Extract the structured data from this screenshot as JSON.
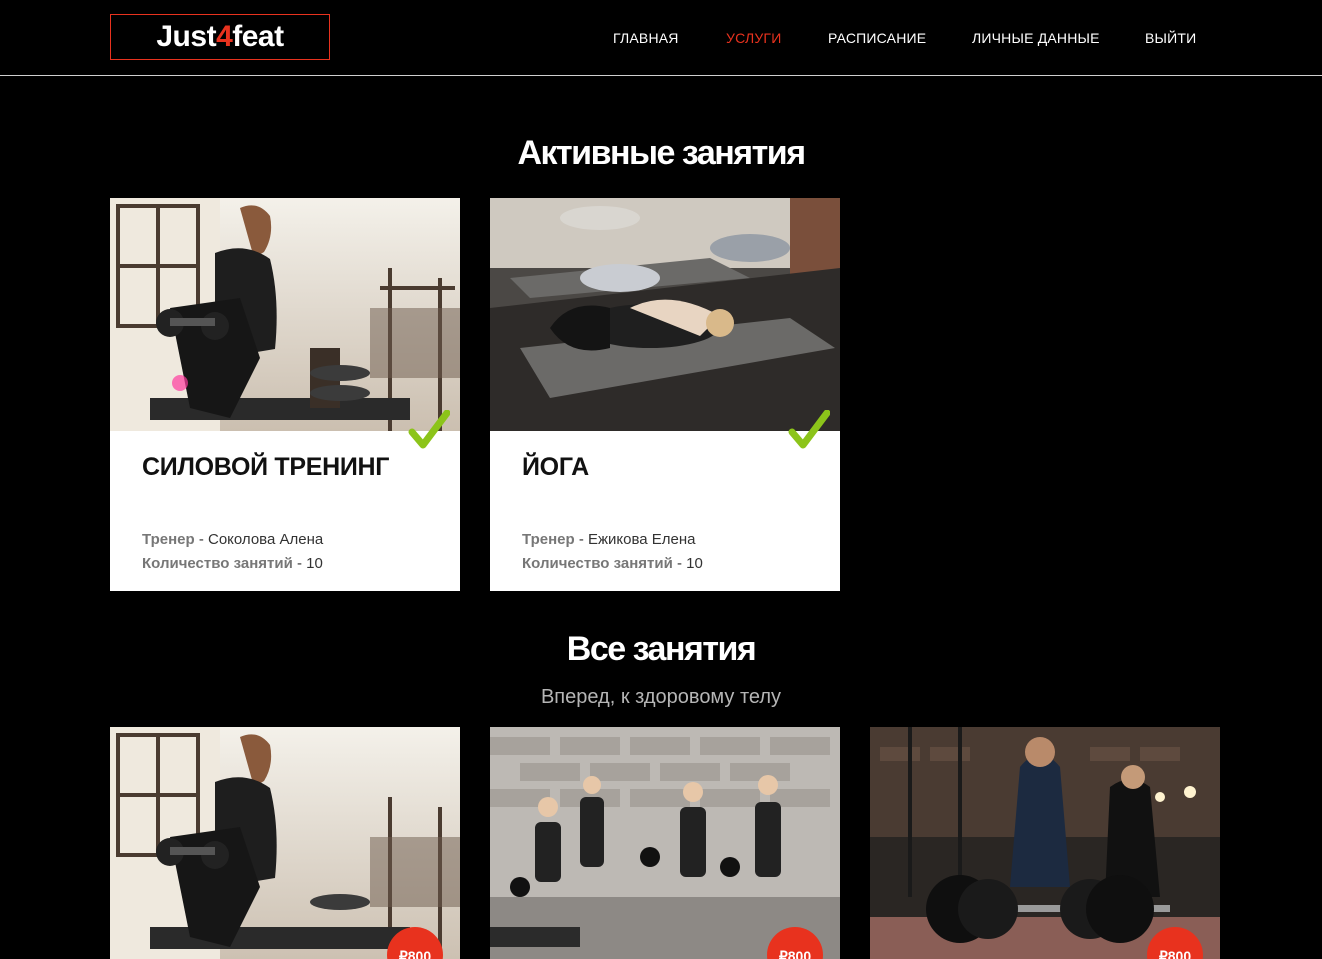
{
  "header": {
    "logo": {
      "part1": "Just",
      "part2": "4",
      "part3": "feat"
    },
    "nav": [
      {
        "label": "ГЛАВНАЯ",
        "active": false
      },
      {
        "label": "УСЛУГИ",
        "active": true
      },
      {
        "label": "РАСПИСАНИЕ",
        "active": false
      },
      {
        "label": "ЛИЧНЫЕ ДАННЫЕ",
        "active": false
      },
      {
        "label": "ВЫЙТИ",
        "active": false
      }
    ]
  },
  "active": {
    "title": "Активные занятия",
    "cards": [
      {
        "name": "СИЛОВОЙ ТРЕНИНГ",
        "trainer_label": "Тренер",
        "trainer": " - Соколова Алена",
        "count_label": "Количество занятий",
        "count": " - 10",
        "image": "strength-training-photo",
        "status_icon": "check-icon"
      },
      {
        "name": "ЙОГА",
        "trainer_label": "Тренер",
        "trainer": " - Ежикова Елена",
        "count_label": "Количество занятий",
        "count": " - 10",
        "image": "yoga-class-photo",
        "status_icon": "check-icon"
      }
    ]
  },
  "all": {
    "title": "Все занятия",
    "subtitle": "Вперед, к здоровому телу",
    "cards": [
      {
        "image": "strength-training-photo",
        "price": "₽800"
      },
      {
        "image": "kettlebell-group-photo",
        "price": "₽800"
      },
      {
        "image": "barbell-deadlift-photo",
        "price": "₽800"
      }
    ]
  },
  "colors": {
    "accent": "#e8321e",
    "check": "#8cc41a",
    "background": "#000000"
  }
}
